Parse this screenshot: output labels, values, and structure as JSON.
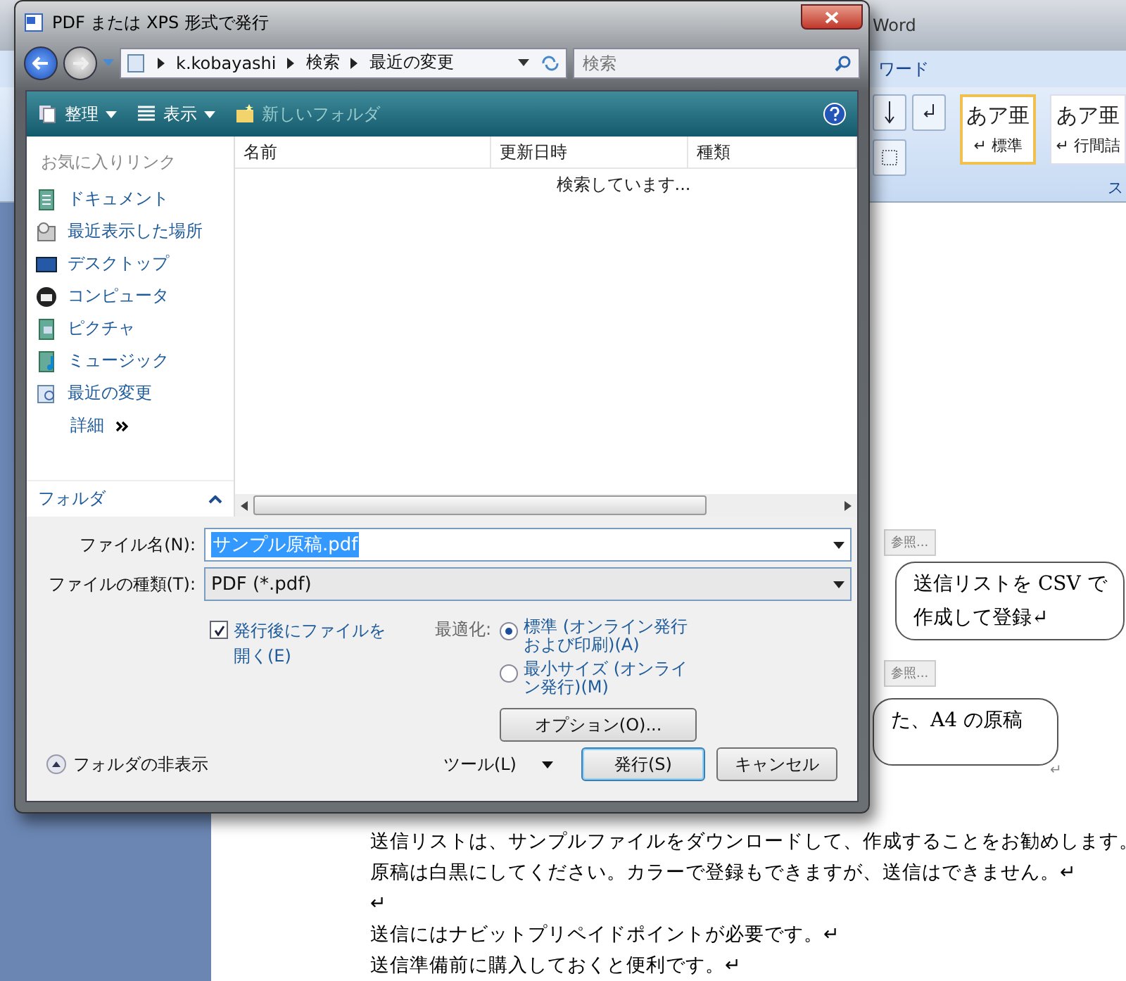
{
  "word": {
    "title": "Word",
    "ribbon_tab": "ワード",
    "styles": [
      {
        "sample": "あア亜",
        "name": "↵ 標準",
        "selected": true
      },
      {
        "sample": "あア亜",
        "name": "↵ 行間詰",
        "selected": false
      }
    ],
    "group_label": "ス",
    "browse_buttons": [
      "参照...",
      "参照..."
    ],
    "callouts": [
      {
        "lines": [
          "送信リストを CSV で",
          "作成して登録↵"
        ]
      },
      {
        "lines": [
          "た、A4 の原稿"
        ],
        "mark": "↵"
      }
    ],
    "paragraphs": [
      "送信リストは、サンプルファイルをダウンロードして、作成することをお勧めします。",
      "原稿は白黒にしてください。カラーで登録もできますが、送信はできません。↵",
      "↵",
      "送信にはナビットプリペイドポイントが必要です。↵",
      "送信準備前に購入しておくと便利です。↵"
    ]
  },
  "dialog": {
    "title": "PDF または XPS 形式で発行",
    "breadcrumbs": [
      "k.kobayashi",
      "検索",
      "最近の変更"
    ],
    "search": {
      "placeholder": "検索"
    },
    "toolbar": [
      {
        "label": "整理",
        "kind": "organize",
        "disabled": false
      },
      {
        "label": "表示",
        "kind": "views",
        "disabled": false
      },
      {
        "label": "新しいフォルダ",
        "kind": "newfolder",
        "disabled": true
      }
    ],
    "favorites_header": "お気に入りリンク",
    "links": [
      {
        "label": "ドキュメント",
        "kind": "document"
      },
      {
        "label": "最近表示した場所",
        "kind": "recent"
      },
      {
        "label": "デスクトップ",
        "kind": "desktop"
      },
      {
        "label": "コンピュータ",
        "kind": "computer"
      },
      {
        "label": "ピクチャ",
        "kind": "pictures"
      },
      {
        "label": "ミュージック",
        "kind": "music"
      },
      {
        "label": "最近の変更",
        "kind": "changes"
      }
    ],
    "more": "詳細",
    "folders": "フォルダ",
    "columns": [
      "名前",
      "更新日時",
      "種類"
    ],
    "status": "検索しています...",
    "file_name": {
      "label": "ファイル名(N):",
      "value": "サンプル原稿.pdf"
    },
    "file_type": {
      "label": "ファイルの種類(T):",
      "value": "PDF (*.pdf)"
    },
    "open_after": {
      "label": "発行後にファイルを開く(E)",
      "checked": true
    },
    "optimize": {
      "label": "最適化:",
      "options": [
        {
          "label": "標準 (オンライン発行および印刷)(A)",
          "selected": true
        },
        {
          "label": "最小サイズ (オンライン発行)(M)",
          "selected": false
        }
      ]
    },
    "options_button": "オプション(O)...",
    "hide_folders": "フォルダの非表示",
    "tools": "ツール(L)",
    "publish": "発行(S)",
    "cancel": "キャンセル"
  }
}
